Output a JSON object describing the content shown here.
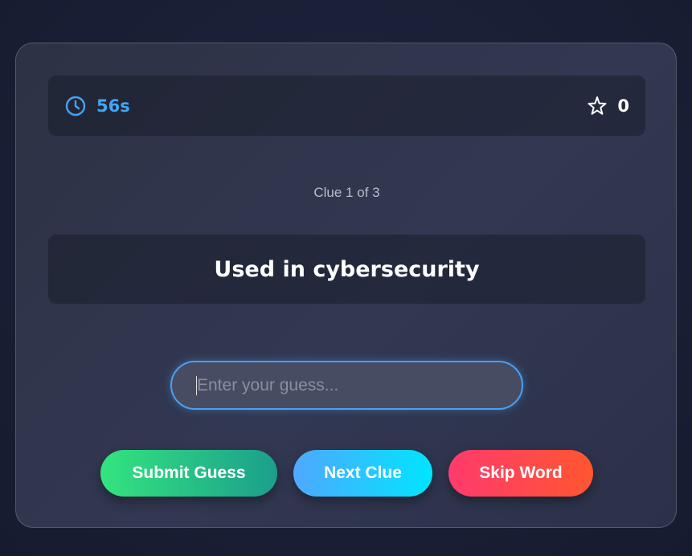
{
  "stats": {
    "timer_icon": "clock-icon",
    "timer_value": "56s",
    "score_icon": "star-icon",
    "score_value": "0"
  },
  "clue": {
    "counter": "Clue 1 of 3",
    "text": "Used in cybersecurity"
  },
  "guess": {
    "value": "",
    "placeholder": "Enter your guess..."
  },
  "buttons": {
    "submit_label": "Submit Guess",
    "next_label": "Next Clue",
    "skip_label": "Skip Word"
  },
  "colors": {
    "accent_blue": "#42a5f5",
    "submit_gradient": [
      "#33e47f",
      "#1c9e8c"
    ],
    "next_gradient": [
      "#4fa8ff",
      "#00e5ff"
    ],
    "skip_gradient": [
      "#ff3a6d",
      "#ff5630"
    ]
  }
}
